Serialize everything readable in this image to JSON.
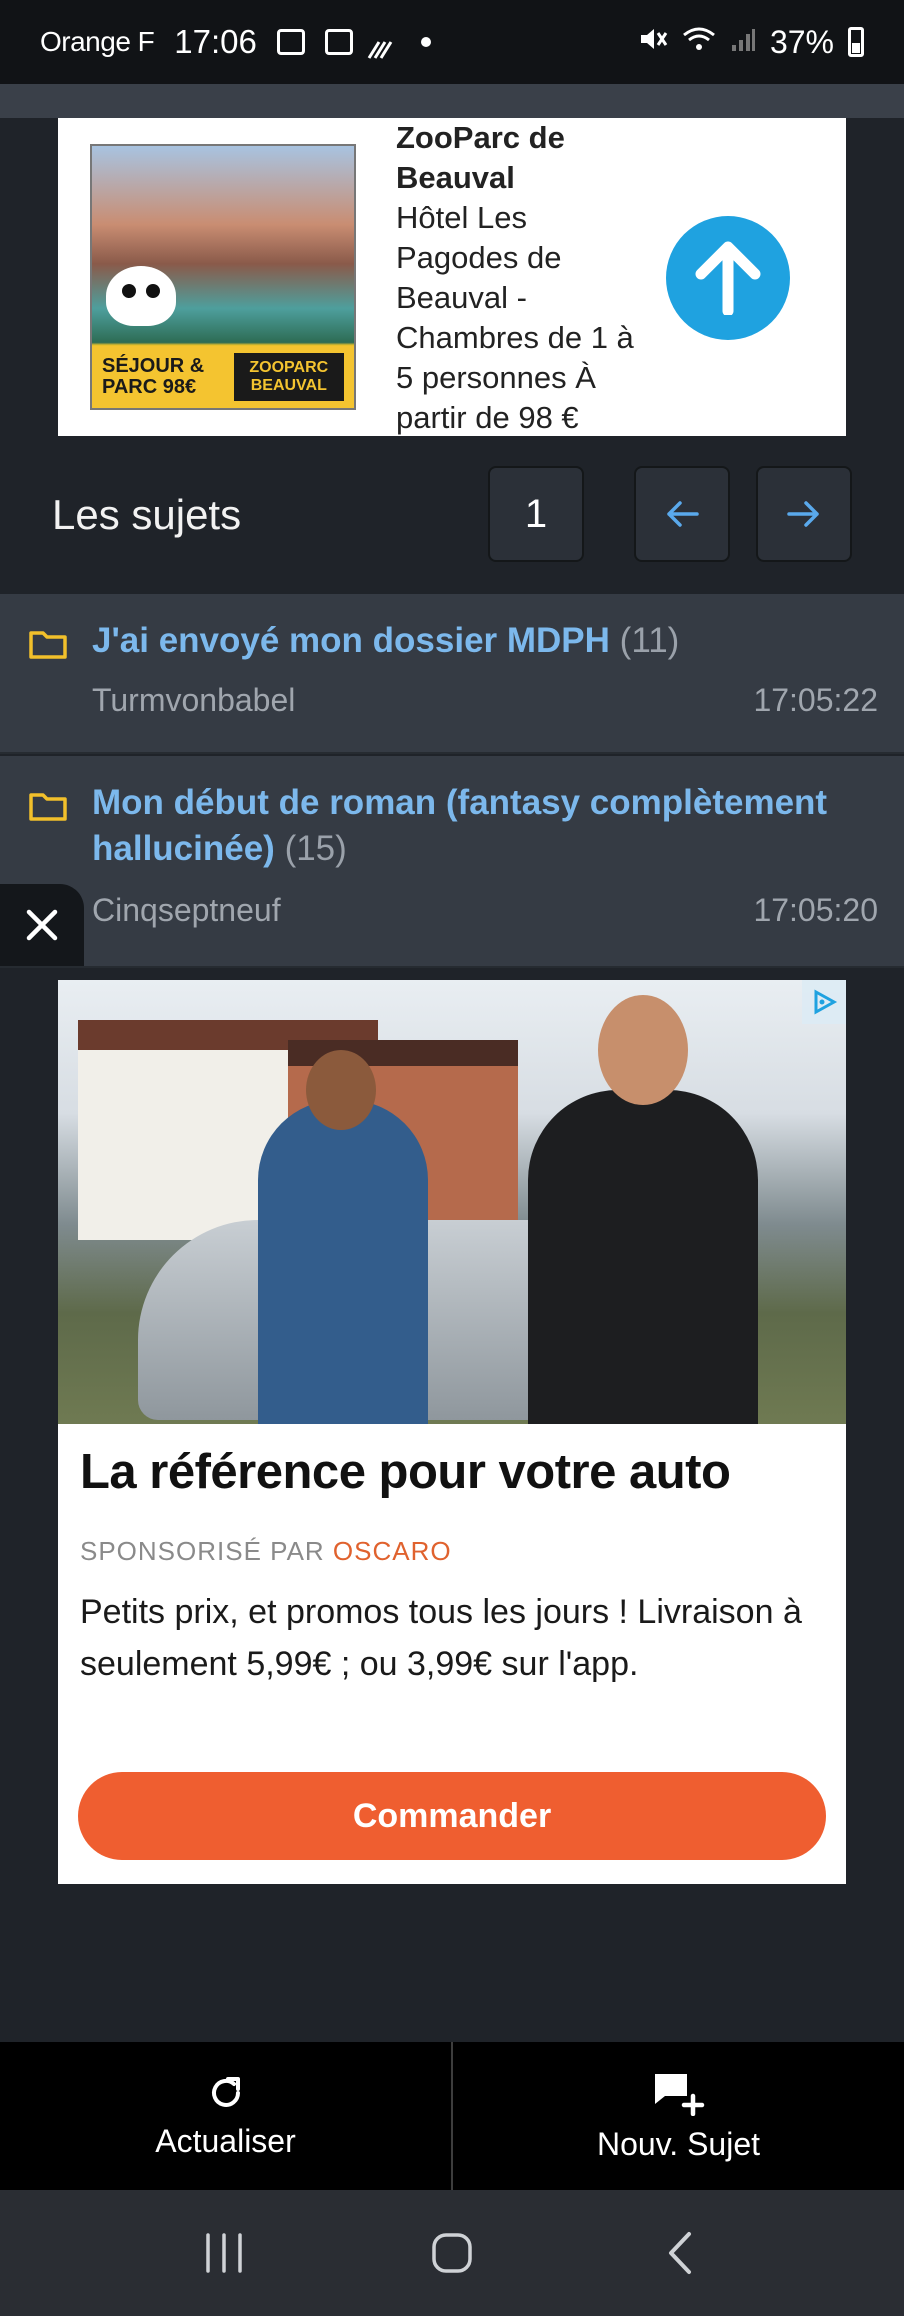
{
  "status_bar": {
    "carrier": "Orange F",
    "time": "17:06",
    "battery": "37%"
  },
  "ad_top": {
    "title": "ZooParc de Beauval",
    "body": "Hôtel Les Pagodes de Beauval - Chambres de 1 à 5 personnes À partir de 98 €",
    "image_promo": "SÉJOUR & PARC 98€",
    "image_logo": "ZOOPARC BEAUVAL",
    "icon": "arrow-up-icon"
  },
  "topics": {
    "title": "Les sujets",
    "page": "1",
    "items": [
      {
        "title": "J'ai envoyé mon dossier MDPH",
        "count": "(11)",
        "author": "Turmvonbabel",
        "time": "17:05:22"
      },
      {
        "title": "Mon début de roman (fantasy complètement hallucinée)",
        "count": "(15)",
        "author": "Cinqseptneuf",
        "time": "17:05:20"
      }
    ]
  },
  "ad_main": {
    "headline": "La référence pour votre auto",
    "sponsor_prefix": "SPONSORISÉ PAR",
    "sponsor_brand": "OSCARO",
    "description": "Petits prix, et promos tous les jours ! Livraison à seulement 5,99€ ; ou 3,99€ sur l'app.",
    "cta": "Commander"
  },
  "actions": {
    "refresh": "Actualiser",
    "new_topic": "Nouv. Sujet"
  },
  "colors": {
    "link": "#7cb8ec",
    "folder": "#f2c02b",
    "cta": "#ef5e30",
    "accent_blue": "#1fa2e0"
  }
}
